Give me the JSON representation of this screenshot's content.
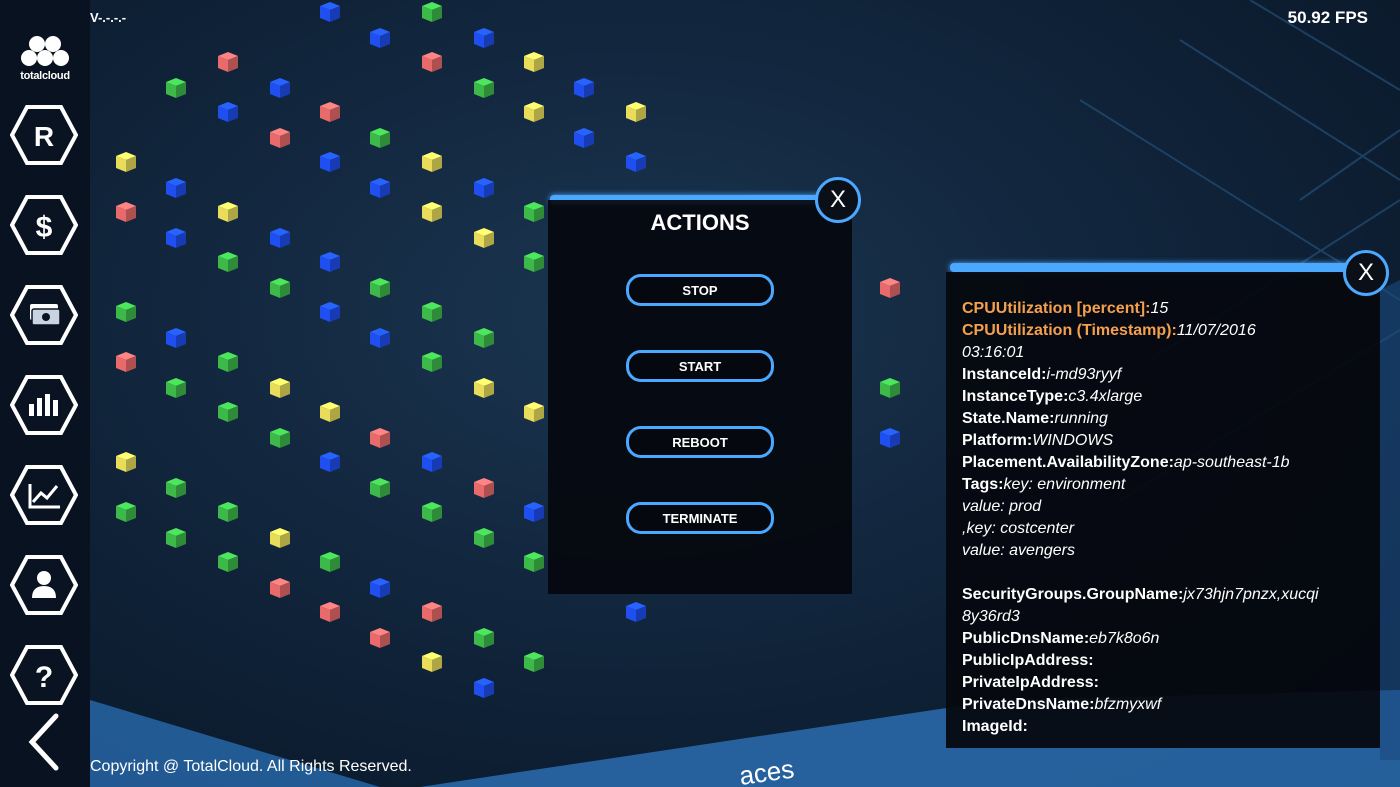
{
  "header": {
    "version": "V-.-.-.-",
    "fps": "50.92 FPS"
  },
  "logo": {
    "text": "totalcloud"
  },
  "sidebar": {
    "items": [
      {
        "name": "resources-button",
        "glyph": "R"
      },
      {
        "name": "cost-button",
        "glyph": "$"
      },
      {
        "name": "billing-button",
        "glyph": "money-icon"
      },
      {
        "name": "metrics-button",
        "glyph": "bar-chart-icon"
      },
      {
        "name": "trends-button",
        "glyph": "line-chart-icon"
      },
      {
        "name": "user-button",
        "glyph": "user-icon"
      },
      {
        "name": "help-button",
        "glyph": "?"
      }
    ]
  },
  "actions_panel": {
    "title": "ACTIONS",
    "close_label": "X",
    "buttons": [
      "STOP",
      "START",
      "REBOOT",
      "TERMINATE"
    ]
  },
  "info_panel": {
    "close_label": "X",
    "lines": [
      {
        "key": "CPUUtilization [percent]:",
        "value": "15",
        "highlight": true
      },
      {
        "key": "CPUUtilization (Timestamp):",
        "value": "11/07/2016",
        "highlight": true
      },
      {
        "key": "",
        "value": "03:16:01"
      },
      {
        "key": "InstanceId:",
        "value": "i-md93ryyf"
      },
      {
        "key": "InstanceType:",
        "value": "c3.4xlarge"
      },
      {
        "key": "State.Name:",
        "value": "running"
      },
      {
        "key": "Platform:",
        "value": "WINDOWS"
      },
      {
        "key": "Placement.AvailabilityZone:",
        "value": "ap-southeast-1b"
      },
      {
        "key": "Tags:",
        "value": "key: environment"
      },
      {
        "key": "",
        "value": "value: prod"
      },
      {
        "key": "",
        "value": ",key: costcenter"
      },
      {
        "key": "",
        "value": "value: avengers"
      },
      {
        "key": "",
        "value": ""
      },
      {
        "key": "SecurityGroups.GroupName:",
        "value": "jx73hjn7pnzx,xucqi"
      },
      {
        "key": "",
        "value": "8y36rd3"
      },
      {
        "key": "PublicDnsName:",
        "value": "eb7k8o6n"
      },
      {
        "key": "PublicIpAddress:",
        "value": ""
      },
      {
        "key": "PrivateIpAddress:",
        "value": ""
      },
      {
        "key": "PrivateDnsName:",
        "value": "bfzmyxwf"
      },
      {
        "key": "ImageId:",
        "value": ""
      }
    ]
  },
  "footer": {
    "copyright": "Copyright @ TotalCloud. All Rights Reserved."
  },
  "colors": {
    "accent": "#4ba8ff",
    "highlight_key": "#f4a04d",
    "cube_blue": "#1f4ff0",
    "cube_green": "#3db94a",
    "cube_yellow": "#e8dc5a",
    "cube_red": "#e86a6a"
  }
}
